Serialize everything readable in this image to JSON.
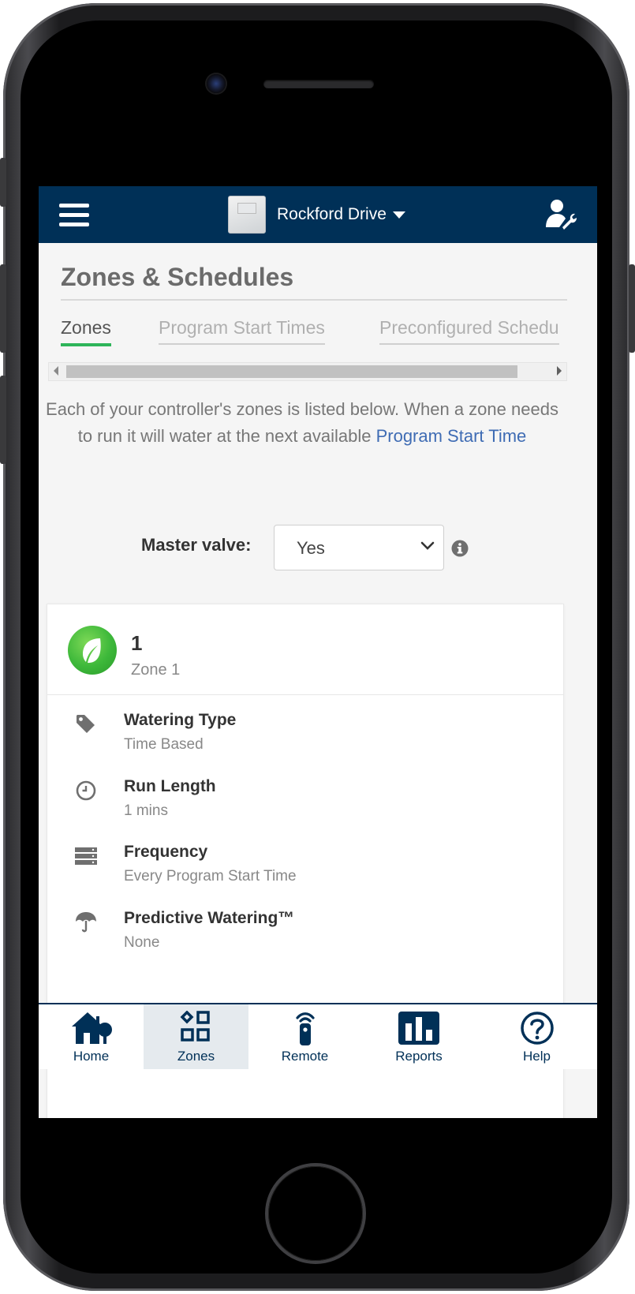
{
  "header": {
    "controller_name": "Rockford Drive"
  },
  "page": {
    "title": "Zones & Schedules"
  },
  "tabs": [
    {
      "label": "Zones",
      "active": true
    },
    {
      "label": "Program Start Times",
      "active": false
    },
    {
      "label": "Preconfigured Schedu",
      "active": false
    }
  ],
  "intro": {
    "text": "Each of your controller's zones is listed below. When a zone needs to run it will water at the next available",
    "link": "Program Start Time"
  },
  "master_valve": {
    "label": "Master valve:",
    "value": "Yes"
  },
  "zone": {
    "number": "1",
    "name": "Zone 1",
    "properties": [
      {
        "label": "Watering Type",
        "value": "Time Based",
        "icon": "tag-icon"
      },
      {
        "label": "Run Length",
        "value": "1 mins",
        "icon": "clock-icon"
      },
      {
        "label": "Frequency",
        "value": "Every Program Start Time",
        "icon": "list-icon"
      },
      {
        "label": "Predictive Watering™",
        "value": "None",
        "icon": "umbrella-icon"
      }
    ]
  },
  "bottom_nav": [
    {
      "label": "Home",
      "icon": "home-icon",
      "active": false
    },
    {
      "label": "Zones",
      "icon": "zones-icon",
      "active": true
    },
    {
      "label": "Remote",
      "icon": "remote-icon",
      "active": false
    },
    {
      "label": "Reports",
      "icon": "reports-icon",
      "active": false
    },
    {
      "label": "Help",
      "icon": "help-icon",
      "active": false
    }
  ],
  "colors": {
    "header_bg": "#003057",
    "active_tab": "#2eb55a",
    "link": "#3f6cb4",
    "zone_badge": "#3db83a"
  }
}
